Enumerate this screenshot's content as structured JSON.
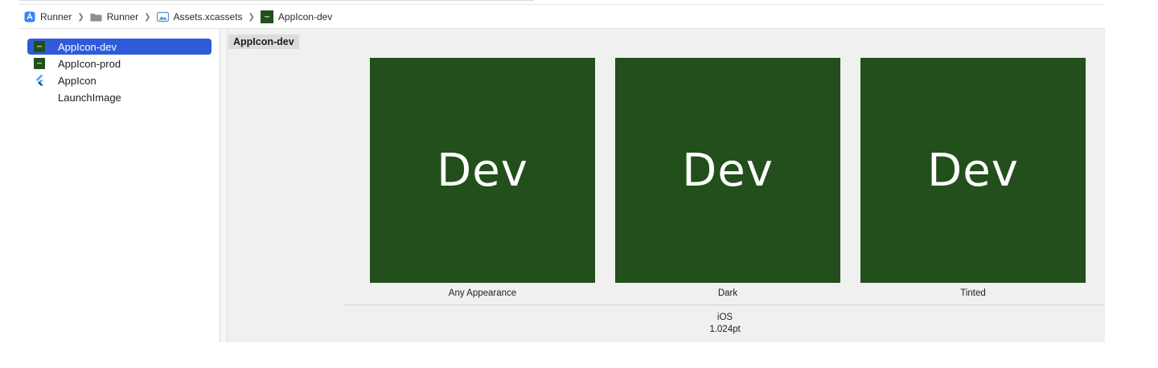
{
  "breadcrumb": [
    {
      "label": "Runner",
      "icon": "xcode-app-icon"
    },
    {
      "label": "Runner",
      "icon": "folder-icon"
    },
    {
      "label": "Assets.xcassets",
      "icon": "asset-catalog-icon"
    },
    {
      "label": "AppIcon-dev",
      "icon": "app-icon-thumbnail"
    }
  ],
  "sidebar": {
    "items": [
      {
        "label": "AppIcon-dev",
        "icon": "app-icon-thumbnail",
        "selected": true
      },
      {
        "label": "AppIcon-prod",
        "icon": "app-icon-thumbnail",
        "selected": false
      },
      {
        "label": "AppIcon",
        "icon": "flutter-icon",
        "selected": false
      },
      {
        "label": "LaunchImage",
        "icon": "",
        "selected": false
      }
    ]
  },
  "editor": {
    "title": "AppIcon-dev",
    "wells": [
      {
        "text": "Dev",
        "label": "Any Appearance"
      },
      {
        "text": "Dev",
        "label": "Dark"
      },
      {
        "text": "Dev",
        "label": "Tinted"
      }
    ],
    "platform": "iOS",
    "size": "1.024pt"
  },
  "colors": {
    "selection": "#2f5bdb",
    "icon_green": "#224f1b",
    "editor_bg": "#f0f0f0"
  }
}
